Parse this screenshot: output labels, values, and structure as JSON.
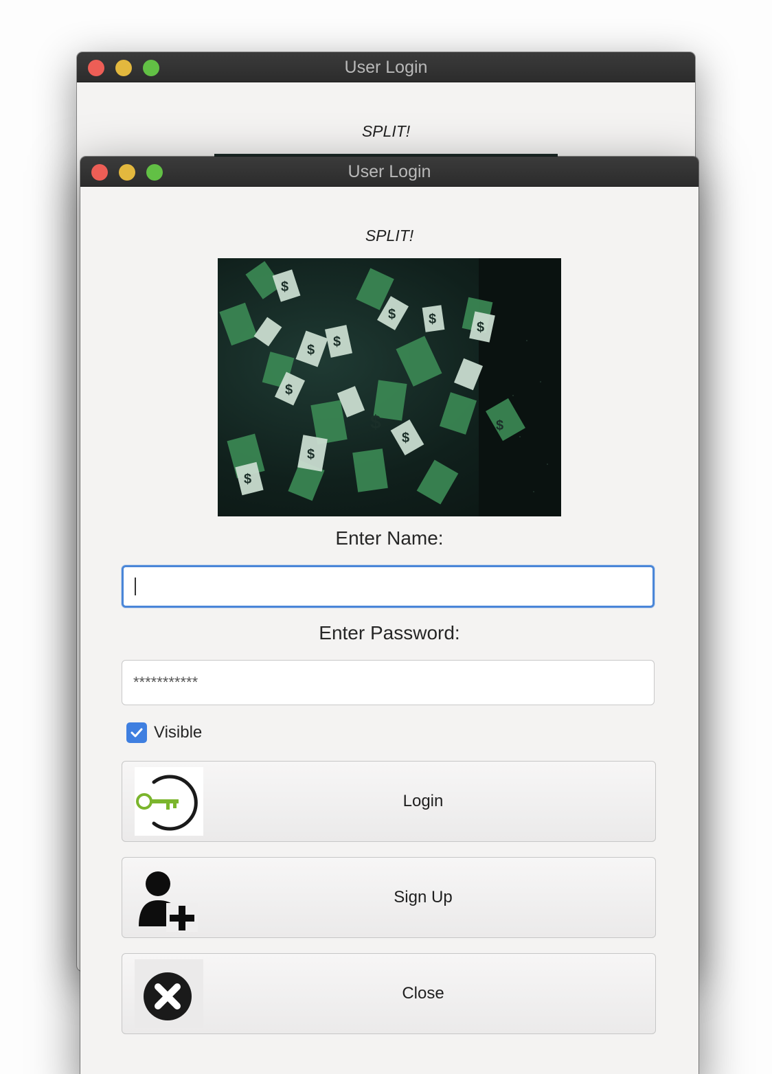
{
  "back_window": {
    "title": "User Login",
    "heading": "SPLIT!"
  },
  "window": {
    "title": "User Login",
    "heading": "SPLIT!",
    "image": {
      "icon": "falling-money-image"
    },
    "name_label": "Enter Name:",
    "name_value": "",
    "password_label": "Enter Password:",
    "password_value": "***********",
    "visible_checkbox": {
      "label": "Visible",
      "checked": true
    },
    "buttons": {
      "login": {
        "label": "Login",
        "icon": "key-login-icon"
      },
      "signup": {
        "label": "Sign Up",
        "icon": "add-user-icon"
      },
      "close": {
        "label": "Close",
        "icon": "close-circle-icon"
      }
    }
  },
  "colors": {
    "titlebar": "#2f2f2f",
    "focus_ring": "#4a86d8",
    "checkbox": "#3f7fe0",
    "key_green": "#7bb52d"
  }
}
